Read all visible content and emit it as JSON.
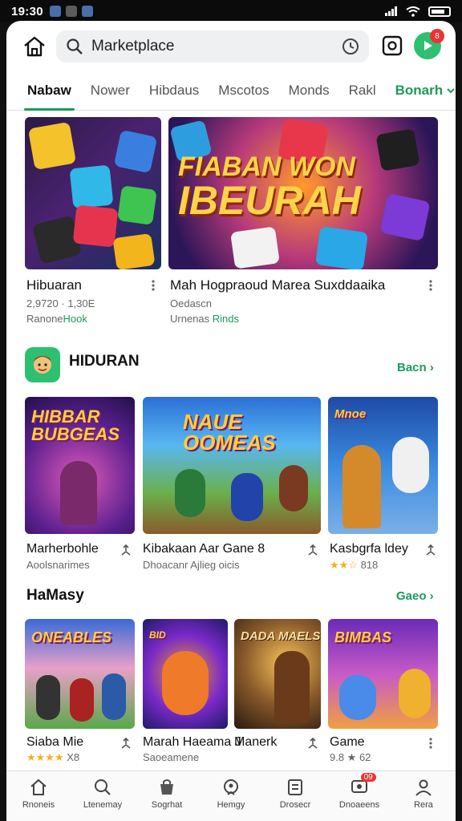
{
  "status_bar": {
    "time": "19:30"
  },
  "search": {
    "value": "Marketplace"
  },
  "notification_count": "8",
  "tabs": [
    "Nabaw",
    "Nower",
    "Hibdaus",
    "Mscotos",
    "Monds",
    "Rakl",
    "Bonarh"
  ],
  "featured": {
    "banner_text_line1": "FIABAN WON",
    "banner_text_line2": "IBEURAH",
    "cards": [
      {
        "title": "Hibuaran",
        "meta": "2,9720 · 1,30E",
        "sub_prefix": "Ranone",
        "sub_link": "Hook"
      },
      {
        "title": "Mah Hogpraoud Marea Suxddaaika",
        "meta": "Oedascn",
        "sub_prefix": "Urnenas",
        "sub_link": "Rinds"
      }
    ]
  },
  "section1": {
    "title": "HIDURAN",
    "see_all": "Bacn",
    "items": [
      {
        "art_text": "HIBBAR BUBGEAS",
        "title": "Marherbohle",
        "sub": "Aoolsnarimes"
      },
      {
        "art_text": "NAUE OOMEAS",
        "title": "Kibakaan Aar Gane 8",
        "sub": "Dhoacanr Ajlieg oicis"
      },
      {
        "art_text": "Mnoe",
        "title": "Kasbgrfa ldey",
        "rating": "★★☆",
        "sub": "818"
      }
    ]
  },
  "section2": {
    "title": "HaMasy",
    "see_all": "Gaeo",
    "items": [
      {
        "art_text": "ONEABLES",
        "title": "Siaba Mie",
        "rating": "★★★★",
        "sub": "X8"
      },
      {
        "art_text": "BID",
        "title": "Marah Haeama J",
        "sub": "Saoeamene"
      },
      {
        "art_text": "DADA MAELS",
        "title": "Manerk",
        "sub": ""
      },
      {
        "art_text": "BIMBAS",
        "title": "Game",
        "sub": "9.8 ★ 62"
      }
    ]
  },
  "bottom_nav": {
    "items": [
      {
        "label": "Rnoneis",
        "icon": "home-icon"
      },
      {
        "label": "Ltenemay",
        "icon": "search-icon"
      },
      {
        "label": "Sogrhat",
        "icon": "store-icon"
      },
      {
        "label": "Hemgy",
        "icon": "help-icon"
      },
      {
        "label": "Drosecr",
        "icon": "list-icon"
      },
      {
        "label": "Dnoaeens",
        "icon": "chat-icon",
        "badge": "09"
      },
      {
        "label": "Rera",
        "icon": "profile-icon"
      }
    ]
  },
  "colors": {
    "accent": "#1a9a5b",
    "badge": "#e33333"
  }
}
